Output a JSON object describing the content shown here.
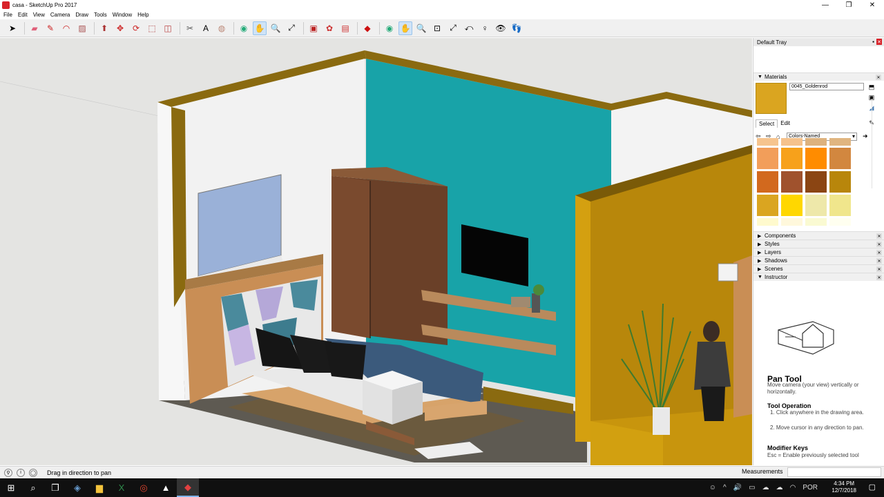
{
  "window": {
    "title": "casa - SketchUp Pro 2017",
    "controls": [
      "—",
      "❐",
      "✕"
    ]
  },
  "menu": [
    "File",
    "Edit",
    "View",
    "Camera",
    "Draw",
    "Tools",
    "Window",
    "Help"
  ],
  "toolbar": {
    "icons": [
      "select-icon",
      "eraser-icon",
      "pencil-icon",
      "arc-icon",
      "rectangle-icon",
      "push-pull-icon",
      "move-icon",
      "rotate-icon",
      "scale-icon",
      "offset-icon",
      "tape-measure-icon",
      "text-icon",
      "paint-bucket-icon",
      "orbit-icon",
      "pan-icon",
      "zoom-icon",
      "zoom-extents-icon",
      "3d-warehouse-icon",
      "extension-warehouse-icon",
      "layout-icon",
      "ruby-icon",
      "orbit-icon-2",
      "pan-icon-2",
      "zoom-icon-2",
      "zoom-window-icon",
      "zoom-extents-icon-2",
      "previous-view-icon",
      "position-camera-icon",
      "look-around-icon",
      "walk-icon"
    ],
    "active": [
      "pan-icon",
      "pan-icon-2"
    ]
  },
  "tray": {
    "title": "Default Tray",
    "materials": {
      "label": "Materials",
      "current_name": "0045_Goldenrod",
      "current_color": "#daa520",
      "tabs": [
        "Select",
        "Edit"
      ],
      "collection": "Colors-Named",
      "swatch_rows": [
        [
          "#f6c48e",
          "#f5c28c",
          "#ddb27e",
          "#e0b580"
        ],
        [
          "#f29e5a",
          "#f7a11b",
          "#ff8c00",
          "#d2873f"
        ],
        [
          "#d2691e",
          "#a0522d",
          "#8b4513",
          "#b8860b"
        ],
        [
          "#daa520",
          "#ffd700",
          "#eee8aa",
          "#f0e68c"
        ],
        [
          "#fffacd",
          "#fff8dc",
          "#fafad2",
          "#fffff0"
        ]
      ]
    },
    "panels": [
      "Components",
      "Styles",
      "Layers",
      "Shadows",
      "Scenes",
      "Instructor"
    ],
    "instructor": {
      "tool_name": "Pan Tool",
      "description": "Move camera (your view) vertically or horizontally.",
      "operation_title": "Tool Operation",
      "step1": "1. Click anywhere in the drawing area.",
      "step2": "2. Move cursor in any direction to pan.",
      "modifier_title": "Modifier Keys",
      "modifier_text": "Esc = Enable previously selected tool"
    }
  },
  "status": {
    "message": "Drag in direction to pan",
    "measurements_label": "Measurements"
  },
  "taskbar": {
    "apps": [
      "windows-start-icon",
      "search-icon",
      "task-view-icon",
      "sketchup-folder-icon",
      "file-explorer-icon",
      "excel-icon",
      "chrome-icon",
      "photos-icon",
      "sketchup-icon"
    ],
    "active_app": "sketchup-icon",
    "lang": "POR",
    "time": "4:34 PM",
    "date": "12/7/2018"
  }
}
